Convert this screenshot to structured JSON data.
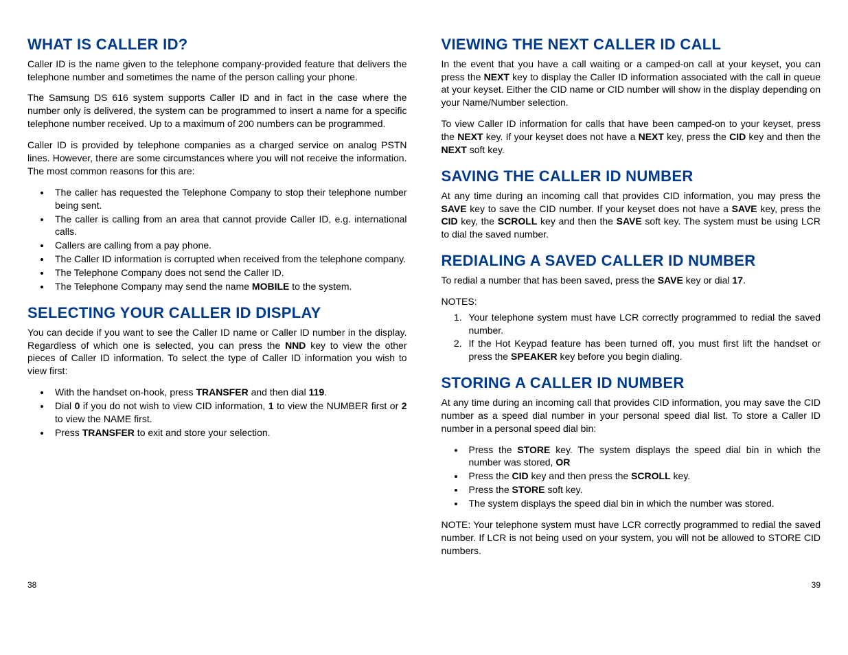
{
  "left": {
    "h1": "WHAT IS CALLER ID?",
    "p1": "Caller ID is the name given to the telephone company-provided feature that delivers the telephone number and sometimes the name of the person calling your phone.",
    "p2": "The Samsung DS 616 system supports Caller ID and in fact in the case where the number only is delivered, the system can be programmed to insert a name for a specific telephone number received. Up to a maximum of 200 numbers can be programmed.",
    "p3": "Caller ID is provided by telephone companies as a charged service on analog PSTN lines. However, there are some circumstances where you will not receive the information. The most common reasons for this are:",
    "ul1": {
      "i1": "The caller has requested the Telephone Company to stop their telephone number being sent.",
      "i2": "The caller is calling from an area that cannot provide Caller ID, e.g. international calls.",
      "i3": "Callers are calling from a pay phone.",
      "i4": "The Caller ID information is corrupted when received from the telephone company.",
      "i5": "The Telephone Company does not send the Caller ID.",
      "i6a": "The Telephone Company may send the name ",
      "i6b": "MOBILE",
      "i6c": " to the system."
    },
    "h2": "SELECTING YOUR CALLER ID DISPLAY",
    "p4a": "You can decide if you want to see the Caller ID name or Caller ID number in the display. Regardless of which one is selected, you can press the ",
    "p4b": "NND",
    "p4c": " key to view the other pieces of Caller ID information. To select the type of Caller ID information you wish to view first:",
    "ul2": {
      "i1a": "With the handset on-hook, press ",
      "i1b": "TRANSFER",
      "i1c": " and then dial ",
      "i1d": "119",
      "i1e": ".",
      "i2a": "Dial ",
      "i2b": "0",
      "i2c": " if you do not wish to view CID information, ",
      "i2d": "1",
      "i2e": " to view the NUMBER first or ",
      "i2f": "2",
      "i2g": " to view the NAME first.",
      "i3a": "Press ",
      "i3b": "TRANSFER",
      "i3c": " to exit and store your selection."
    },
    "pagenum": "38"
  },
  "right": {
    "h1": "VIEWING THE NEXT CALLER ID CALL",
    "p1a": "In the event that you have a call waiting or a camped-on call at your keyset, you can press the ",
    "p1b": "NEXT",
    "p1c": " key to display the Caller ID information associated with the call in queue at your keyset. Either the CID name or CID number will show in the display depending on your Name/Number selection.",
    "p2a": "To view Caller ID information for calls that have been camped-on to your keyset, press the ",
    "p2b": "NEXT",
    "p2c": " key. If your keyset does not have a ",
    "p2d": "NEXT",
    "p2e": " key, press the ",
    "p2f": "CID",
    "p2g": " key and then the ",
    "p2h": "NEXT",
    "p2i": " soft key.",
    "h2": "SAVING THE CALLER ID NUMBER",
    "p3a": "At any time during an incoming call that provides CID information, you may press the ",
    "p3b": "SAVE",
    "p3c": " key to save the CID number. If your keyset does not have a ",
    "p3d": "SAVE",
    "p3e": " key, press the ",
    "p3f": "CID",
    "p3g": " key, the ",
    "p3h": "SCROLL",
    "p3i": " key and then the ",
    "p3j": "SAVE",
    "p3k": " soft key. The system must be using LCR to dial the saved number.",
    "h3": "REDIALING A SAVED CALLER ID NUMBER",
    "p4a": "To redial a number that has been saved, press the ",
    "p4b": "SAVE",
    "p4c": " key or dial ",
    "p4d": "17",
    "p4e": ".",
    "notes": "NOTES:",
    "ol1": {
      "i1": "Your telephone system must have LCR correctly programmed to redial the saved number.",
      "i2a": "If the Hot Keypad feature has been turned off, you must first lift the handset or press the ",
      "i2b": "SPEAKER",
      "i2c": " key before you begin dialing."
    },
    "h4": "STORING A CALLER ID NUMBER",
    "p5": "At any time during an incoming call that provides CID information, you may save the CID number as a speed dial number in your personal speed dial list. To store a Caller ID number in a personal speed dial bin:",
    "ul1": {
      "i1a": "Press the ",
      "i1b": "STORE",
      "i1c": " key. The system displays the speed dial bin in which the number was stored, ",
      "i1d": "OR",
      "i2a": "Press the ",
      "i2b": "CID",
      "i2c": " key and then press the ",
      "i2d": "SCROLL",
      "i2e": " key.",
      "i3a": "Press the ",
      "i3b": "STORE",
      "i3c": " soft key.",
      "i4": "The system displays the speed dial bin in which the number was stored."
    },
    "p6": "NOTE: Your telephone system must have LCR correctly programmed to redial the saved number. If LCR is not being used on your system, you will not be allowed to STORE CID numbers.",
    "pagenum": "39"
  }
}
